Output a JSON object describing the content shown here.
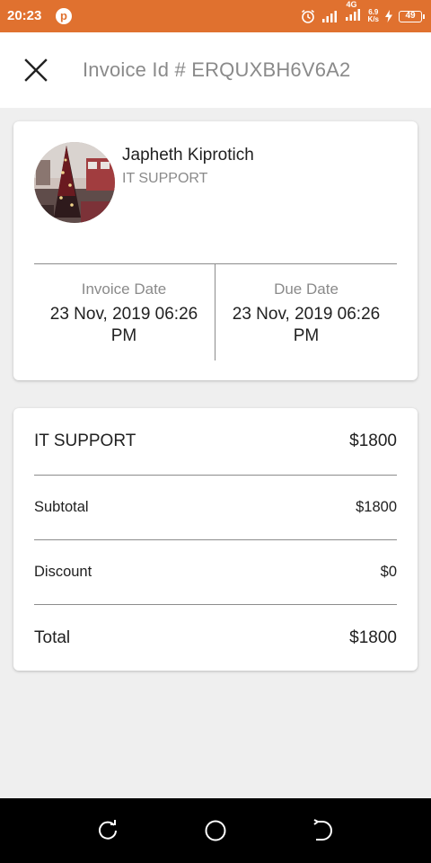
{
  "status_bar": {
    "time": "20:23",
    "app_badge": "p",
    "network_label": "4G",
    "speed_value": "6.9",
    "speed_unit": "K/s",
    "battery": "49"
  },
  "header": {
    "title": "Invoice Id # ERQUXBH6V6A2",
    "close_icon": "close-icon"
  },
  "client": {
    "name": "Japheth Kiprotich",
    "role": "IT SUPPORT"
  },
  "dates": {
    "invoice_label": "Invoice Date",
    "invoice_value": "23 Nov, 2019 06:26 PM",
    "due_label": "Due Date",
    "due_value": "23 Nov, 2019 06:26 PM"
  },
  "items": [
    {
      "label": "IT SUPPORT",
      "amount": "$1800"
    }
  ],
  "totals": {
    "subtotal_label": "Subtotal",
    "subtotal_value": "$1800",
    "discount_label": "Discount",
    "discount_value": "$0",
    "total_label": "Total",
    "total_value": "$1800"
  },
  "colors": {
    "status_bar": "#e0712f",
    "background": "#efefef",
    "card": "#ffffff",
    "muted_text": "#8a8a8a"
  },
  "nav": {
    "back_icon": "recent-apps-icon",
    "home_icon": "home-circle-icon",
    "recents_icon": "back-icon"
  }
}
